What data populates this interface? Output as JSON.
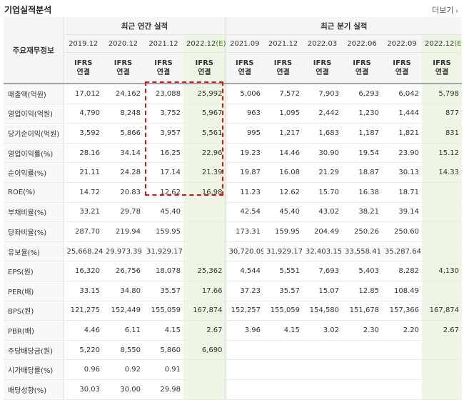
{
  "title": "기업실적분석",
  "more_label": "더보기",
  "header": {
    "row_label": "주요재무정보",
    "groups": [
      "최근 연간 실적",
      "최근 분기 실적"
    ],
    "periods": [
      "2019.12",
      "2020.12",
      "2021.12",
      "2022.12",
      "2021.09",
      "2021.12",
      "2022.03",
      "2022.06",
      "2022.09",
      "2022.12"
    ],
    "est_mark": "(E)",
    "ifrs_line1": "IFRS",
    "ifrs_line2": "연결"
  },
  "rows": [
    {
      "label": "매출액(억원)",
      "values": [
        "17,012",
        "24,162",
        "23,088",
        "25,992",
        "5,006",
        "7,572",
        "7,903",
        "6,293",
        "6,042",
        "5,798"
      ]
    },
    {
      "label": "영업이익(억원)",
      "values": [
        "4,790",
        "8,248",
        "3,752",
        "5,967",
        "963",
        "1,095",
        "2,442",
        "1,230",
        "1,444",
        "877"
      ]
    },
    {
      "label": "당기순이익(억원)",
      "values": [
        "3,592",
        "5,866",
        "3,957",
        "5,561",
        "995",
        "1,217",
        "1,683",
        "1,187",
        "1,821",
        "831"
      ]
    },
    {
      "label": "영업이익률(%)",
      "values": [
        "28.16",
        "34.14",
        "16.25",
        "22.96",
        "19.23",
        "14.46",
        "30.90",
        "19.54",
        "23.90",
        "15.12"
      ]
    },
    {
      "label": "순이익률(%)",
      "values": [
        "21.11",
        "24.28",
        "17.14",
        "21.39",
        "19.87",
        "16.08",
        "21.29",
        "18.87",
        "30.13",
        "14.33"
      ]
    },
    {
      "label": "ROE(%)",
      "values": [
        "14.72",
        "20.83",
        "12.62",
        "16.98",
        "11.23",
        "12.62",
        "15.70",
        "16.38",
        "18.71",
        ""
      ]
    },
    {
      "label": "부채비율(%)",
      "values": [
        "33.21",
        "29.78",
        "45.40",
        "",
        "42.54",
        "45.40",
        "43.02",
        "38.21",
        "39.14",
        ""
      ]
    },
    {
      "label": "당좌비율(%)",
      "values": [
        "287.70",
        "219.94",
        "159.95",
        "",
        "173.31",
        "159.95",
        "204.49",
        "250.26",
        "250.60",
        ""
      ]
    },
    {
      "label": "유보율(%)",
      "values": [
        "25,668.24",
        "29,973.39",
        "31,929.17",
        "",
        "30,720.09",
        "31,929.17",
        "32,403.15",
        "33,558.41",
        "35,287.64",
        ""
      ]
    },
    {
      "label": "EPS(원)",
      "values": [
        "16,320",
        "26,756",
        "18,078",
        "25,362",
        "4,544",
        "5,551",
        "7,693",
        "5,403",
        "8,282",
        "4,130"
      ]
    },
    {
      "label": "PER(배)",
      "values": [
        "33.15",
        "34.80",
        "35.57",
        "17.66",
        "37.23",
        "35.57",
        "15.07",
        "12.85",
        "108.49",
        ""
      ]
    },
    {
      "label": "BPS(원)",
      "values": [
        "121,275",
        "152,449",
        "155,059",
        "167,874",
        "152,257",
        "155,059",
        "154,580",
        "151,678",
        "157,366",
        "167,874"
      ]
    },
    {
      "label": "PBR(배)",
      "values": [
        "4.46",
        "6.11",
        "4.15",
        "2.67",
        "3.96",
        "4.15",
        "3.02",
        "2.30",
        "2.20",
        "2.67"
      ]
    },
    {
      "label": "주당배당금(원)",
      "values": [
        "5,220",
        "8,550",
        "5,860",
        "6,690",
        "",
        "",
        "",
        "",
        "",
        ""
      ]
    },
    {
      "label": "시가배당률(%)",
      "values": [
        "0.96",
        "0.92",
        "0.91",
        "",
        "",
        "",
        "",
        "",
        "",
        ""
      ]
    },
    {
      "label": "배당성향(%)",
      "values": [
        "30.03",
        "30.00",
        "29.98",
        "",
        "",
        "",
        "",
        "",
        "",
        ""
      ]
    }
  ]
}
